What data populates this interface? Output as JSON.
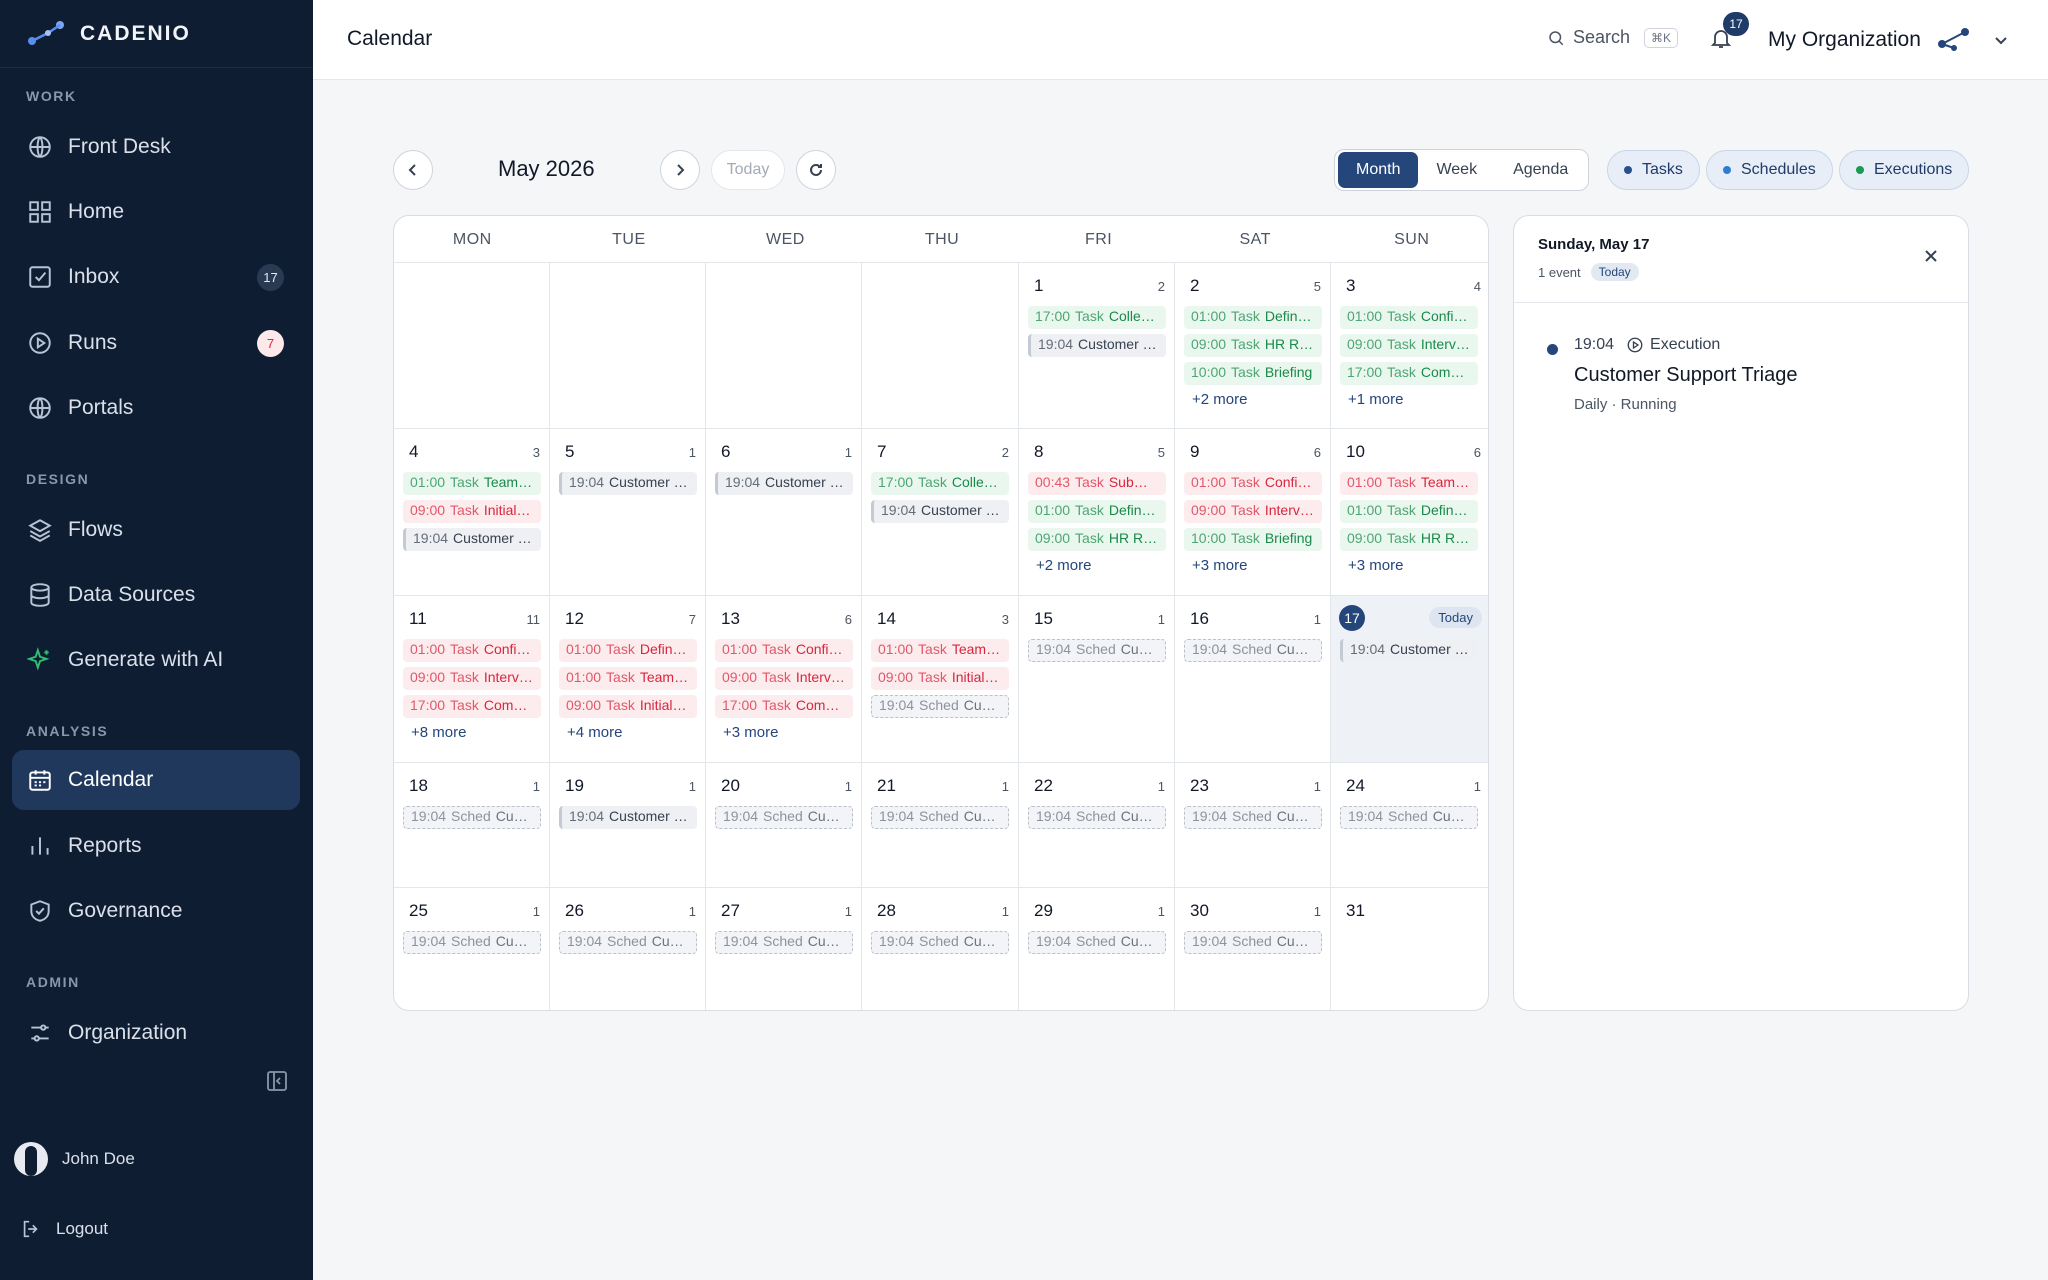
{
  "sidebar": {
    "brand": "CADENIO",
    "sections": {
      "work": "WORK",
      "design": "DESIGN",
      "analysis": "ANALYSIS",
      "admin": "ADMIN"
    },
    "items": {
      "front_desk": "Front Desk",
      "home": "Home",
      "inbox": "Inbox",
      "inbox_badge": "17",
      "runs": "Runs",
      "runs_badge": "7",
      "portals": "Portals",
      "flows": "Flows",
      "data_sources": "Data Sources",
      "generate_ai": "Generate with AI",
      "calendar": "Calendar",
      "reports": "Reports",
      "governance": "Governance",
      "organization": "Organization"
    },
    "user": "John Doe",
    "logout": "Logout"
  },
  "header": {
    "title": "Calendar",
    "search": "Search",
    "shortcut": "⌘K",
    "notifications": "17",
    "org": "My Organization"
  },
  "toolbar": {
    "month": "May 2026",
    "today": "Today",
    "views": [
      "Month",
      "Week",
      "Agenda"
    ],
    "active_view": "Month",
    "filters": [
      {
        "label": "Tasks",
        "color": "#2a4f8a"
      },
      {
        "label": "Schedules",
        "color": "#2a7fd4"
      },
      {
        "label": "Executions",
        "color": "#1a9a52"
      }
    ]
  },
  "calendar": {
    "weekdays": [
      "MON",
      "TUE",
      "WED",
      "THU",
      "FRI",
      "SAT",
      "SUN"
    ],
    "today_label": "Today",
    "weeks": [
      [
        null,
        null,
        null,
        null,
        {
          "day": "1",
          "count": "2",
          "events": [
            {
              "time": "17:00",
              "kind": "Task",
              "name": "Collect Feedback",
              "type": "green"
            },
            {
              "time": "19:04",
              "kind": "",
              "name": "Customer Support Triage",
              "type": "gray"
            }
          ]
        },
        {
          "day": "2",
          "count": "5",
          "events": [
            {
              "time": "01:00",
              "kind": "Task",
              "name": "Define Goals",
              "type": "green"
            },
            {
              "time": "09:00",
              "kind": "Task",
              "name": "HR Review",
              "type": "green"
            },
            {
              "time": "10:00",
              "kind": "Task",
              "name": "Briefing",
              "type": "green"
            }
          ],
          "more": "+2 more"
        },
        {
          "day": "3",
          "count": "4",
          "events": [
            {
              "time": "01:00",
              "kind": "Task",
              "name": "Confirm Plan",
              "type": "green"
            },
            {
              "time": "09:00",
              "kind": "Task",
              "name": "Interview",
              "type": "green"
            },
            {
              "time": "17:00",
              "kind": "Task",
              "name": "Compile Report",
              "type": "green"
            }
          ],
          "more": "+1 more"
        }
      ],
      [
        {
          "day": "4",
          "count": "3",
          "events": [
            {
              "time": "01:00",
              "kind": "Task",
              "name": "Team Sync",
              "type": "green"
            },
            {
              "time": "09:00",
              "kind": "Task",
              "name": "Initial Review",
              "type": "red"
            },
            {
              "time": "19:04",
              "kind": "",
              "name": "Customer Support Triage",
              "type": "gray"
            }
          ]
        },
        {
          "day": "5",
          "count": "1",
          "events": [
            {
              "time": "19:04",
              "kind": "",
              "name": "Customer Support Triage",
              "type": "gray"
            }
          ]
        },
        {
          "day": "6",
          "count": "1",
          "events": [
            {
              "time": "19:04",
              "kind": "",
              "name": "Customer Support Triage",
              "type": "gray"
            }
          ]
        },
        {
          "day": "7",
          "count": "2",
          "events": [
            {
              "time": "17:00",
              "kind": "Task",
              "name": "Collect Feedback",
              "type": "green"
            },
            {
              "time": "19:04",
              "kind": "",
              "name": "Customer Support Triage",
              "type": "gray"
            }
          ]
        },
        {
          "day": "8",
          "count": "5",
          "events": [
            {
              "time": "00:43",
              "kind": "Task",
              "name": "Submit Report",
              "type": "red"
            },
            {
              "time": "01:00",
              "kind": "Task",
              "name": "Define Goals",
              "type": "green"
            },
            {
              "time": "09:00",
              "kind": "Task",
              "name": "HR Review",
              "type": "green"
            }
          ],
          "more": "+2 more"
        },
        {
          "day": "9",
          "count": "6",
          "events": [
            {
              "time": "01:00",
              "kind": "Task",
              "name": "Confirm Plan",
              "type": "red"
            },
            {
              "time": "09:00",
              "kind": "Task",
              "name": "Interview",
              "type": "red"
            },
            {
              "time": "10:00",
              "kind": "Task",
              "name": "Briefing",
              "type": "green"
            }
          ],
          "more": "+3 more"
        },
        {
          "day": "10",
          "count": "6",
          "events": [
            {
              "time": "01:00",
              "kind": "Task",
              "name": "Team Sync",
              "type": "red"
            },
            {
              "time": "01:00",
              "kind": "Task",
              "name": "Define Goals",
              "type": "green"
            },
            {
              "time": "09:00",
              "kind": "Task",
              "name": "HR Review",
              "type": "green"
            }
          ],
          "more": "+3 more"
        }
      ],
      [
        {
          "day": "11",
          "count": "11",
          "events": [
            {
              "time": "01:00",
              "kind": "Task",
              "name": "Confirm Plan",
              "type": "red"
            },
            {
              "time": "09:00",
              "kind": "Task",
              "name": "Interview",
              "type": "red"
            },
            {
              "time": "17:00",
              "kind": "Task",
              "name": "Compile Report",
              "type": "red"
            }
          ],
          "more": "+8 more"
        },
        {
          "day": "12",
          "count": "7",
          "events": [
            {
              "time": "01:00",
              "kind": "Task",
              "name": "Define Goals",
              "type": "red"
            },
            {
              "time": "01:00",
              "kind": "Task",
              "name": "Team Sync",
              "type": "red"
            },
            {
              "time": "09:00",
              "kind": "Task",
              "name": "Initial Review",
              "type": "red"
            }
          ],
          "more": "+4 more"
        },
        {
          "day": "13",
          "count": "6",
          "events": [
            {
              "time": "01:00",
              "kind": "Task",
              "name": "Confirm Plan",
              "type": "red"
            },
            {
              "time": "09:00",
              "kind": "Task",
              "name": "Interview",
              "type": "red"
            },
            {
              "time": "17:00",
              "kind": "Task",
              "name": "Compile Report",
              "type": "red"
            }
          ],
          "more": "+3 more"
        },
        {
          "day": "14",
          "count": "3",
          "events": [
            {
              "time": "01:00",
              "kind": "Task",
              "name": "Team Sync",
              "type": "red"
            },
            {
              "time": "09:00",
              "kind": "Task",
              "name": "Initial Review",
              "type": "red"
            },
            {
              "time": "19:04",
              "kind": "Sched",
              "name": "Customer Support Triage",
              "type": "sched"
            }
          ]
        },
        {
          "day": "15",
          "count": "1",
          "events": [
            {
              "time": "19:04",
              "kind": "Sched",
              "name": "Customer Support Triage",
              "type": "sched"
            }
          ]
        },
        {
          "day": "16",
          "count": "1",
          "events": [
            {
              "time": "19:04",
              "kind": "Sched",
              "name": "Customer Support Triage",
              "type": "sched"
            }
          ]
        },
        {
          "day": "17",
          "count": "",
          "today": true,
          "events": [
            {
              "time": "19:04",
              "kind": "",
              "name": "Customer Support Triage",
              "type": "gray"
            }
          ]
        }
      ],
      [
        {
          "day": "18",
          "count": "1",
          "events": [
            {
              "time": "19:04",
              "kind": "Sched",
              "name": "Customer Support Triage",
              "type": "sched"
            }
          ]
        },
        {
          "day": "19",
          "count": "1",
          "events": [
            {
              "time": "19:04",
              "kind": "",
              "name": "Customer Support Triage",
              "type": "gray"
            }
          ]
        },
        {
          "day": "20",
          "count": "1",
          "events": [
            {
              "time": "19:04",
              "kind": "Sched",
              "name": "Customer Support Triage",
              "type": "sched"
            }
          ]
        },
        {
          "day": "21",
          "count": "1",
          "events": [
            {
              "time": "19:04",
              "kind": "Sched",
              "name": "Customer Support Triage",
              "type": "sched"
            }
          ]
        },
        {
          "day": "22",
          "count": "1",
          "events": [
            {
              "time": "19:04",
              "kind": "Sched",
              "name": "Customer Support Triage",
              "type": "sched"
            }
          ]
        },
        {
          "day": "23",
          "count": "1",
          "events": [
            {
              "time": "19:04",
              "kind": "Sched",
              "name": "Customer Support Triage",
              "type": "sched"
            }
          ]
        },
        {
          "day": "24",
          "count": "1",
          "events": [
            {
              "time": "19:04",
              "kind": "Sched",
              "name": "Customer Support Triage",
              "type": "sched"
            }
          ]
        }
      ],
      [
        {
          "day": "25",
          "count": "1",
          "events": [
            {
              "time": "19:04",
              "kind": "Sched",
              "name": "Customer Support Triage",
              "type": "sched"
            }
          ]
        },
        {
          "day": "26",
          "count": "1",
          "events": [
            {
              "time": "19:04",
              "kind": "Sched",
              "name": "Customer Support Triage",
              "type": "sched"
            }
          ]
        },
        {
          "day": "27",
          "count": "1",
          "events": [
            {
              "time": "19:04",
              "kind": "Sched",
              "name": "Customer Support Triage",
              "type": "sched"
            }
          ]
        },
        {
          "day": "28",
          "count": "1",
          "events": [
            {
              "time": "19:04",
              "kind": "Sched",
              "name": "Customer Support Triage",
              "type": "sched"
            }
          ]
        },
        {
          "day": "29",
          "count": "1",
          "events": [
            {
              "time": "19:04",
              "kind": "Sched",
              "name": "Customer Support Triage",
              "type": "sched"
            }
          ]
        },
        {
          "day": "30",
          "count": "1",
          "events": [
            {
              "time": "19:04",
              "kind": "Sched",
              "name": "Customer Support Triage",
              "type": "sched"
            }
          ]
        },
        {
          "day": "31",
          "count": "",
          "events": []
        }
      ]
    ]
  },
  "panel": {
    "date": "Sunday, May 17",
    "count": "1 event",
    "today": "Today",
    "event": {
      "time": "19:04",
      "kind": "Execution",
      "title": "Customer Support Triage",
      "meta": "Daily · Running"
    }
  }
}
